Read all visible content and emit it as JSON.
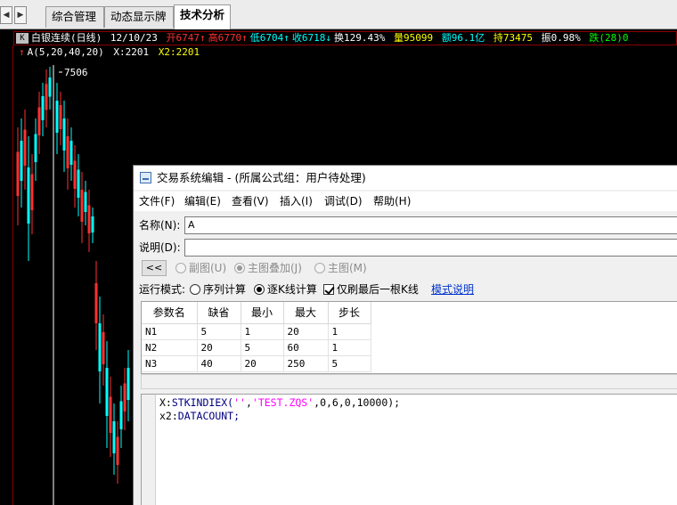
{
  "tabs": {
    "scroll_left": "◀",
    "scroll_right": "▶",
    "items": [
      "综合管理",
      "动态显示牌",
      "技术分析"
    ]
  },
  "quote": {
    "k_label": "K",
    "name": "白银连续(日线)",
    "date": "12/10/23",
    "open": "开6747↑",
    "high": "高6770↑",
    "low": "低6704↑",
    "close": "收6718↓",
    "turnover": "换129.43%",
    "volume": "量95099",
    "amount": "额96.1亿",
    "position": "持73475",
    "amplitude": "振0.98%",
    "change": "跌(28)0"
  },
  "formula_line": {
    "marker": "↑",
    "name": "A(5,20,40,20)",
    "x_value": "X:2201",
    "x2_value": "X2:2201"
  },
  "chart": {
    "peak_label": "7506",
    "colors": {
      "up": "#ff3030",
      "down": "#00ffff",
      "frame": "#8b0000",
      "white": "#ffffff"
    }
  },
  "dialog": {
    "title": "交易系统编辑 - (所属公式组：用户待处理)",
    "menu": [
      "文件(F)",
      "编辑(E)",
      "查看(V)",
      "插入(I)",
      "调试(D)",
      "帮助(H)"
    ],
    "name_label": "名称(N):",
    "name_value": "A",
    "desc_label": "说明(D):",
    "desc_value": "",
    "collapse_label": "<<",
    "chart_options": [
      "副图(U)",
      "主图叠加(J)",
      "主图(M)"
    ],
    "run_mode_label": "运行模式:",
    "run_modes": [
      "序列计算",
      "逐K线计算"
    ],
    "last_bar_only": "仅刷最后一根K线",
    "mode_help": "模式说明",
    "param_headers": [
      "参数名",
      "缺省",
      "最小",
      "最大",
      "步长"
    ],
    "params": [
      [
        "N1",
        "5",
        "1",
        "20",
        "1"
      ],
      [
        "N2",
        "20",
        "5",
        "60",
        "1"
      ],
      [
        "N3",
        "40",
        "20",
        "250",
        "5"
      ]
    ],
    "code": {
      "line1_var": "X:",
      "line1_fn": "STKINDIEX(",
      "line1_arg1": "''",
      "line1_sep": ",",
      "line1_arg2": "'TEST.ZQS'",
      "line1_rest": ",0,6,0,10000);",
      "line2_var": "x2:",
      "line2_fn": "DATACOUNT;"
    }
  }
}
